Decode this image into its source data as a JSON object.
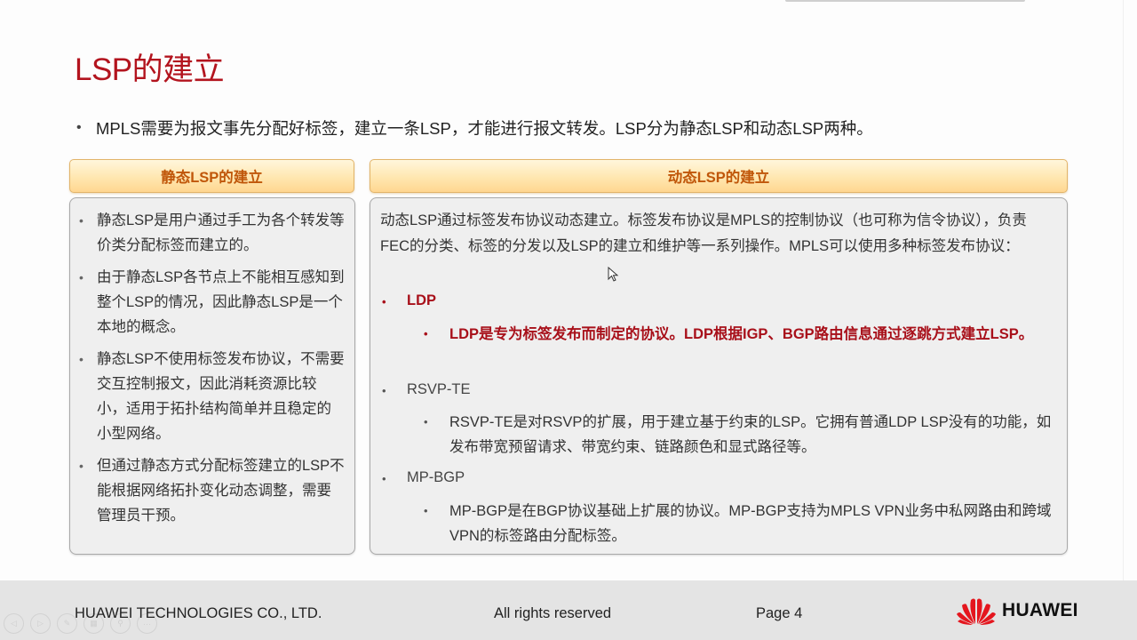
{
  "slide": {
    "title": "LSP的建立",
    "intro": "MPLS需要为报文事先分配好标签，建立一条LSP，才能进行报文转发。LSP分为静态LSP和动态LSP两种。",
    "colors": {
      "title": "#b3141e",
      "header_text": "#c0570a",
      "highlight": "#a8101a"
    }
  },
  "static_lsp": {
    "header": "静态LSP的建立",
    "items": [
      "静态LSP是用户通过手工为各个转发等价类分配标签而建立的。",
      "由于静态LSP各节点上不能相互感知到整个LSP的情况，因此静态LSP是一个本地的概念。",
      "静态LSP不使用标签发布协议，不需要交互控制报文，因此消耗资源比较小，适用于拓扑结构简单并且稳定的小型网络。",
      "但通过静态方式分配标签建立的LSP不能根据网络拓扑变化动态调整，需要管理员干预。"
    ]
  },
  "dynamic_lsp": {
    "header": "动态LSP的建立",
    "intro": "动态LSP通过标签发布协议动态建立。标签发布协议是MPLS的控制协议（也可称为信令协议），负责FEC的分类、标签的分发以及LSP的建立和维护等一系列操作。MPLS可以使用多种标签发布协议：",
    "protocols": [
      {
        "name": "LDP",
        "desc": "LDP是专为标签发布而制定的协议。LDP根据IGP、BGP路由信息通过逐跳方式建立LSP。",
        "highlighted": true
      },
      {
        "name": "RSVP-TE",
        "desc": "RSVP-TE是对RSVP的扩展，用于建立基于约束的LSP。它拥有普通LDP LSP没有的功能，如发布带宽预留请求、带宽约束、链路颜色和显式路径等。",
        "highlighted": false
      },
      {
        "name": "MP-BGP",
        "desc": "MP-BGP是在BGP协议基础上扩展的协议。MP-BGP支持为MPLS VPN业务中私网路由和跨域VPN的标签路由分配标签。",
        "highlighted": false
      }
    ]
  },
  "footer": {
    "company": "HUAWEI TECHNOLOGIES CO., LTD.",
    "rights": "All rights reserved",
    "page": "Page 4",
    "logo_text": "HUAWEI",
    "logo_color": "#e4161e"
  },
  "slideshow_controls": [
    {
      "icon": "previous-icon",
      "glyph": "◁"
    },
    {
      "icon": "next-icon",
      "glyph": "▷"
    },
    {
      "icon": "pen-icon",
      "glyph": "✎"
    },
    {
      "icon": "slides-grid-icon",
      "glyph": "▦"
    },
    {
      "icon": "zoom-icon",
      "glyph": "⚲"
    },
    {
      "icon": "more-icon",
      "glyph": "···"
    }
  ]
}
